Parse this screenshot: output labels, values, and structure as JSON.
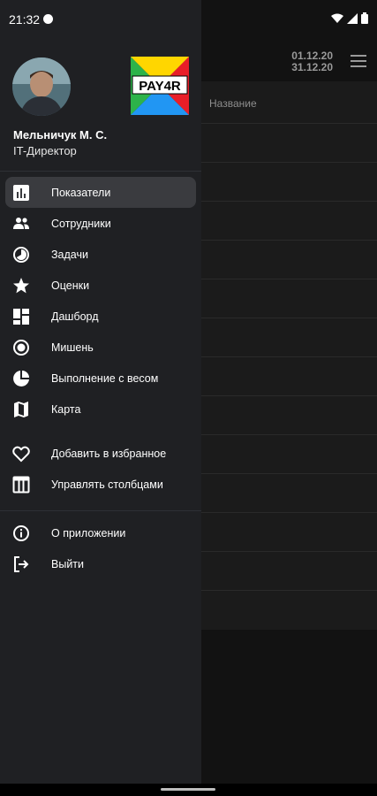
{
  "status_bar": {
    "time": "21:32"
  },
  "background": {
    "date_from": "01.12.20",
    "date_to": "31.12.20",
    "column_header": "Название"
  },
  "drawer": {
    "user_name": "Мельничук М. С.",
    "user_role": "IT-Директор",
    "logo_text": "PAY4R",
    "items": [
      {
        "label": "Показатели",
        "icon": "bar-chart-icon",
        "active": true
      },
      {
        "label": "Сотрудники",
        "icon": "people-icon"
      },
      {
        "label": "Задачи",
        "icon": "clock-icon"
      },
      {
        "label": "Оценки",
        "icon": "star-icon"
      },
      {
        "label": "Дашборд",
        "icon": "dashboard-icon"
      },
      {
        "label": "Мишень",
        "icon": "target-icon"
      },
      {
        "label": "Выполнение с весом",
        "icon": "pie-icon"
      },
      {
        "label": "Карта",
        "icon": "map-icon"
      }
    ],
    "extra_items": [
      {
        "label": "Добавить в избранное",
        "icon": "heart-icon"
      },
      {
        "label": "Управлять столбцами",
        "icon": "columns-icon"
      }
    ],
    "footer_items": [
      {
        "label": "О приложении",
        "icon": "info-icon"
      },
      {
        "label": "Выйти",
        "icon": "logout-icon"
      }
    ]
  }
}
